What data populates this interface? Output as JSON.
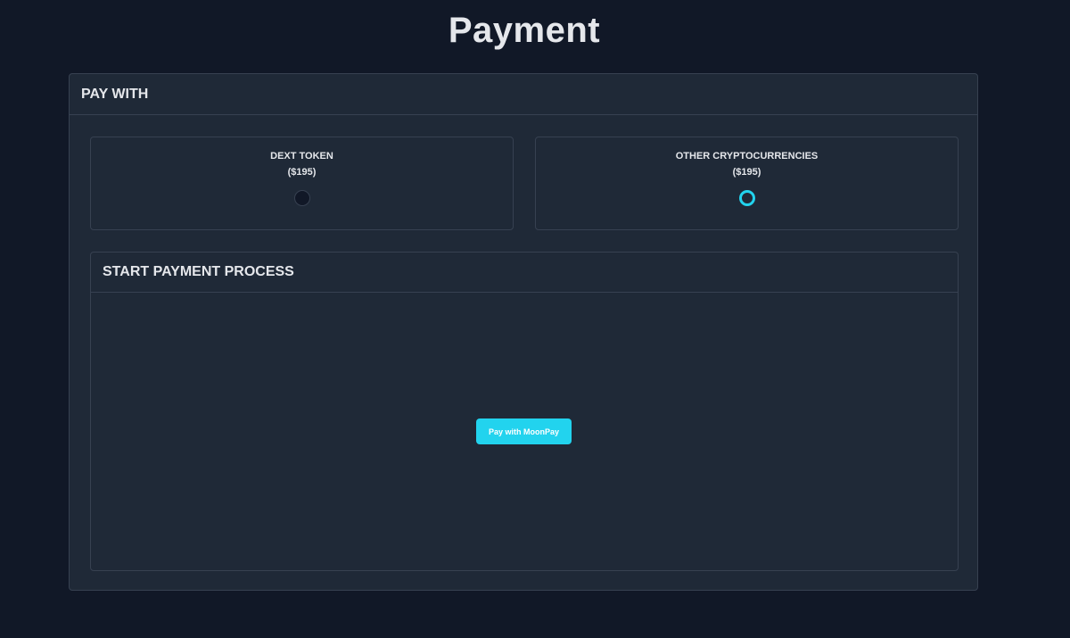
{
  "page": {
    "title": "Payment"
  },
  "pay_with": {
    "header": "PAY WITH",
    "options": [
      {
        "name": "DEXT TOKEN",
        "price": "($195)",
        "selected": false
      },
      {
        "name": "OTHER CRYPTOCURRENCIES",
        "price": "($195)",
        "selected": true
      }
    ]
  },
  "payment_process": {
    "header": "START PAYMENT PROCESS",
    "button_label": "Pay with MoonPay"
  },
  "colors": {
    "background": "#111827",
    "card": "#1f2937",
    "border": "#374151",
    "accent": "#22d3ee",
    "text": "#e5e7eb"
  }
}
